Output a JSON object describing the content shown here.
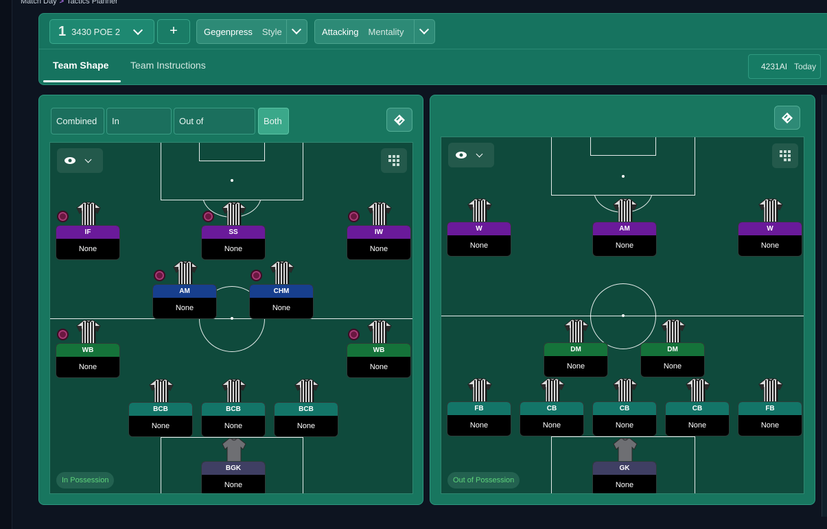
{
  "breadcrumb": {
    "parent": "Match Day",
    "current": "Tactics Planner"
  },
  "header": {
    "tactic_number": "1",
    "tactic_name": "3430 POE 2",
    "add_label": "+",
    "style": {
      "value": "Gegenpress",
      "label": "Style"
    },
    "mentality": {
      "value": "Attacking",
      "label": "Mentality"
    },
    "tabs": [
      "Team Shape",
      "Team Instructions"
    ],
    "active_tab": "Team Shape",
    "date_value": "4231AI",
    "date_label": "Today"
  },
  "phase_modes": [
    "Combined",
    "In Possession",
    "Out of Possession",
    "Both"
  ],
  "active_mode": "Both",
  "left_pitch": {
    "phase_label": "In Possession",
    "players": [
      {
        "role": "IF",
        "name": "None",
        "color": "purple",
        "badge": true
      },
      {
        "role": "SS",
        "name": "None",
        "color": "purple",
        "badge": true
      },
      {
        "role": "IW",
        "name": "None",
        "color": "purple",
        "badge": true
      },
      {
        "role": "AM",
        "name": "None",
        "color": "blue",
        "badge": true
      },
      {
        "role": "CHM",
        "name": "None",
        "color": "blue",
        "badge": true
      },
      {
        "role": "WB",
        "name": "None",
        "color": "green",
        "badge": true
      },
      {
        "role": "WB",
        "name": "None",
        "color": "green",
        "badge": true
      },
      {
        "role": "BCB",
        "name": "None",
        "color": "teal",
        "badge": false
      },
      {
        "role": "BCB",
        "name": "None",
        "color": "teal",
        "badge": false
      },
      {
        "role": "BCB",
        "name": "None",
        "color": "teal",
        "badge": false
      },
      {
        "role": "BGK",
        "name": "None",
        "color": "slate",
        "badge": false,
        "keeper": true
      }
    ]
  },
  "right_pitch": {
    "phase_label": "Out of Possession",
    "players": [
      {
        "role": "W",
        "name": "None",
        "color": "purple"
      },
      {
        "role": "AM",
        "name": "None",
        "color": "purple"
      },
      {
        "role": "W",
        "name": "None",
        "color": "purple"
      },
      {
        "role": "DM",
        "name": "None",
        "color": "green"
      },
      {
        "role": "DM",
        "name": "None",
        "color": "green"
      },
      {
        "role": "FB",
        "name": "None",
        "color": "teal"
      },
      {
        "role": "CB",
        "name": "None",
        "color": "teal"
      },
      {
        "role": "CB",
        "name": "None",
        "color": "teal"
      },
      {
        "role": "CB",
        "name": "None",
        "color": "teal"
      },
      {
        "role": "FB",
        "name": "None",
        "color": "teal"
      },
      {
        "role": "GK",
        "name": "None",
        "color": "slate",
        "keeper": true
      }
    ]
  },
  "icons": [
    "eye-icon",
    "chevron-down-icon",
    "grid-icon",
    "swap-icon"
  ]
}
